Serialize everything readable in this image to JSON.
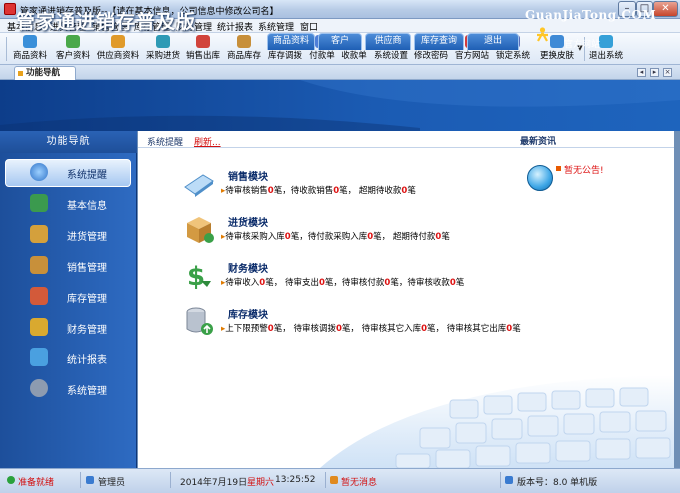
{
  "window": {
    "title": "管家通进销存普及版--【请在基本信息，公司信息中修改公司名】",
    "controls": [
      "minimize",
      "maximize",
      "close"
    ]
  },
  "menu": [
    "基本信息",
    "进货管理",
    "销售管理",
    "库存管理",
    "财务管理",
    "统计报表",
    "系统管理",
    "窗口"
  ],
  "toolbar": [
    {
      "label": "商品资料",
      "icon": "product-icon",
      "color": "#3a8fd9"
    },
    {
      "label": "客户资料",
      "icon": "customer-icon",
      "color": "#4aa84a"
    },
    {
      "label": "供应商资料",
      "icon": "supplier-icon",
      "color": "#e09a2a"
    },
    {
      "label": "采购进货",
      "icon": "purchase-icon",
      "color": "#2e9ab5"
    },
    {
      "label": "销售出库",
      "icon": "sales-out-icon",
      "color": "#d1433b"
    },
    {
      "label": "商品库存",
      "icon": "inventory-icon",
      "color": "#c78f3a"
    },
    {
      "label": "库存调拨",
      "icon": "transfer-icon",
      "color": "#e64747"
    },
    {
      "label": "付款单",
      "icon": "payment-icon",
      "color": "#4f7fd8"
    },
    {
      "label": "收款单",
      "icon": "receipt-icon",
      "color": "#3aa05a"
    },
    {
      "label": "系统设置",
      "icon": "settings-icon",
      "color": "#3fa6c9"
    },
    {
      "label": "修改密码",
      "icon": "password-icon",
      "color": "#e0a33a"
    },
    {
      "label": "官方网站",
      "icon": "website-icon",
      "color": "#d23b3b"
    },
    {
      "label": "锁定系统",
      "icon": "lock-icon",
      "color": "#5b6fb8"
    },
    {
      "label": "更换皮肤",
      "icon": "skin-icon",
      "color": "#3f8ad6"
    },
    {
      "label": "退出系统",
      "icon": "exit-icon",
      "color": "#35a0d8"
    }
  ],
  "tab": {
    "label": "功能导航"
  },
  "banner": {
    "title": "管家通进销存普及版",
    "url": "GuanJiaTong.COM",
    "site_label": "官方网站",
    "nav": [
      "商品资料",
      "客户",
      "供应商",
      "库存查询",
      "退出"
    ]
  },
  "sidebar": {
    "title": "功能导航",
    "items": [
      {
        "label": "系统提醒",
        "icon": "info-icon",
        "color": "#2f72c8",
        "active": true
      },
      {
        "label": "基本信息",
        "icon": "blocks-icon",
        "color": "#3b9a4e"
      },
      {
        "label": "进货管理",
        "icon": "box-in-icon",
        "color": "#d4a03c"
      },
      {
        "label": "销售管理",
        "icon": "box-out-icon",
        "color": "#c8903a"
      },
      {
        "label": "库存管理",
        "icon": "warehouse-icon",
        "color": "#d35a3a"
      },
      {
        "label": "财务管理",
        "icon": "coins-icon",
        "color": "#d9a92f"
      },
      {
        "label": "统计报表",
        "icon": "chart-icon",
        "color": "#4aa0e0"
      },
      {
        "label": "系统管理",
        "icon": "gears-icon",
        "color": "#8d9bb0"
      }
    ]
  },
  "main": {
    "breadcrumb": "系统提醒",
    "refresh": "刷新...",
    "news_title": "最新资讯",
    "news_item": "暂无公告!"
  },
  "modules": [
    {
      "title": "销售模块",
      "icon": "sales-module-icon",
      "parts": [
        [
          "待审核销售",
          "0",
          "笔，"
        ],
        [
          "待收款销售",
          "0",
          "笔，"
        ],
        [
          "超期待收款",
          "0",
          "笔"
        ]
      ]
    },
    {
      "title": "进货模块",
      "icon": "purchase-module-icon",
      "parts": [
        [
          "待审核采购入库",
          "0",
          "笔，"
        ],
        [
          "待付款采购入库",
          "0",
          "笔，"
        ],
        [
          "超期待付款",
          "0",
          "笔"
        ]
      ]
    },
    {
      "title": "财务模块",
      "icon": "finance-module-icon",
      "parts": [
        [
          "待审收入",
          "0",
          "笔，"
        ],
        [
          "待审支出",
          "0",
          "笔，"
        ],
        [
          "待审核付款",
          "0",
          "笔，"
        ],
        [
          "待审核收款",
          "0",
          "笔"
        ]
      ]
    },
    {
      "title": "库存模块",
      "icon": "inventory-module-icon",
      "parts": [
        [
          "上下限预警",
          "0",
          "笔，"
        ],
        [
          "待审核调拨",
          "0",
          "笔，"
        ],
        [
          "待审核其它入库",
          "0",
          "笔，"
        ],
        [
          "待审核其它出库",
          "0",
          "笔"
        ]
      ]
    }
  ],
  "status": {
    "ready": "准备就绪",
    "user": "管理员",
    "date": "2014年7月19日",
    "weekday": "星期六",
    "time": "13:25:52",
    "message": "暂无消息",
    "version": "版本号：8.0 单机版"
  }
}
